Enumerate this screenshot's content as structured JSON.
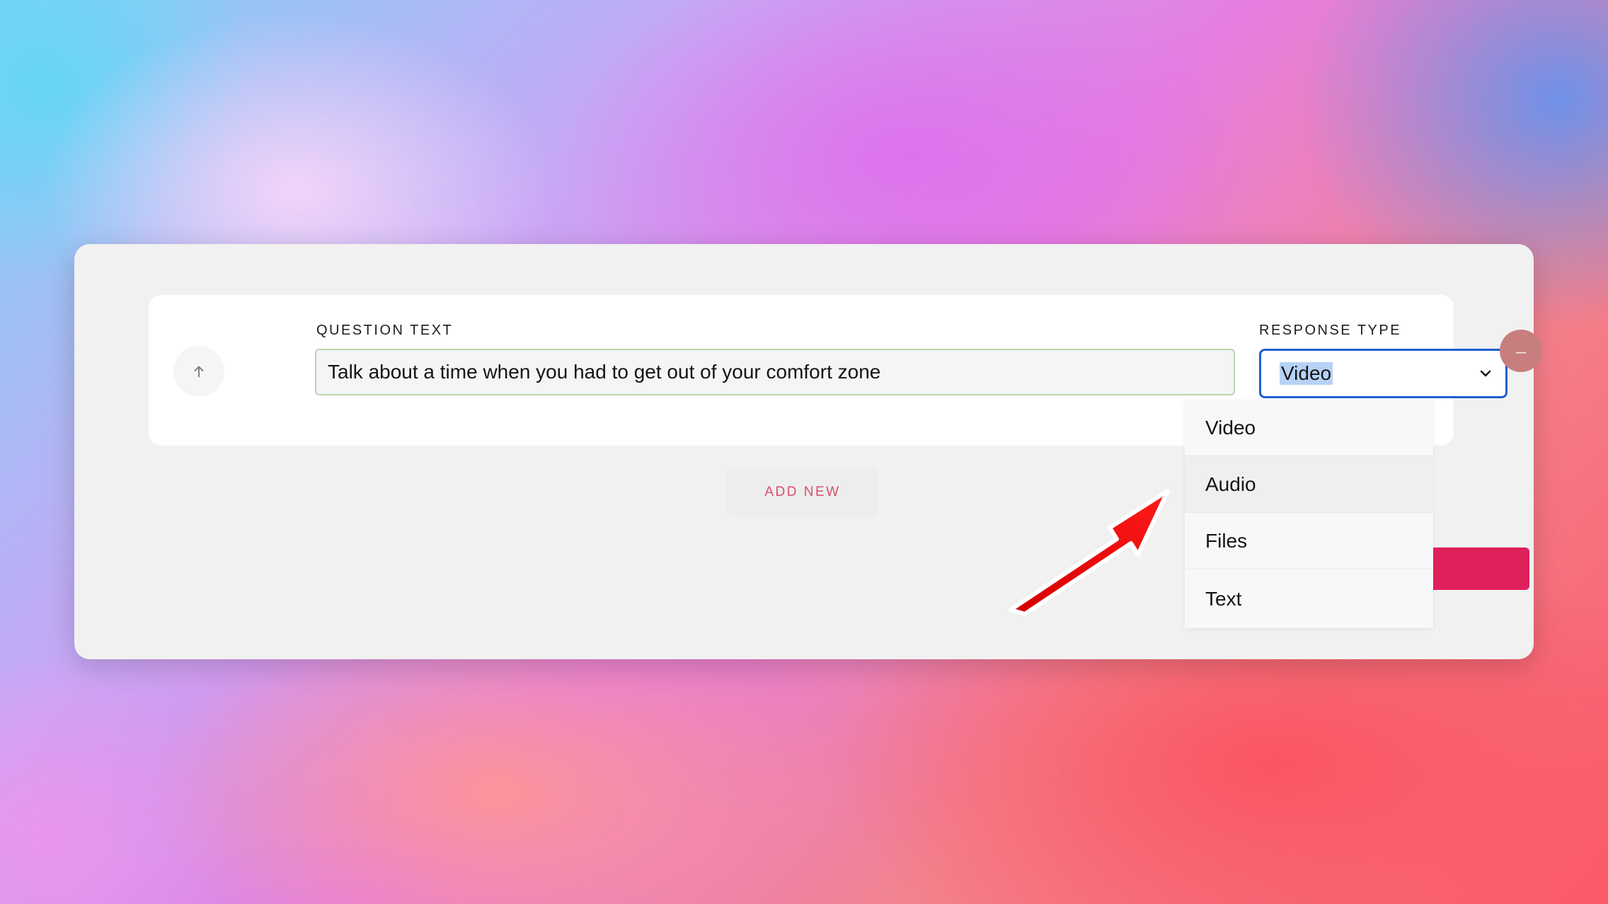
{
  "question": {
    "label": "QUESTION TEXT",
    "value": "Talk about a time when you had to get out of your comfort zone"
  },
  "response": {
    "label": "RESPONSE TYPE",
    "selected": "Video",
    "options": [
      "Video",
      "Audio",
      "Files",
      "Text"
    ]
  },
  "actions": {
    "add_new_label": "ADD NEW",
    "remove_symbol": "–"
  },
  "icons": {
    "move_up": "arrow-up-icon",
    "select": "chevron-down-icon",
    "annotation": "red-arrow-annotation"
  },
  "colors": {
    "accent": "#e0205a",
    "focus_border": "#1f5fd0",
    "input_border": "#b9d4ad",
    "remove_button": "#c87e7e",
    "annotation_arrow": "#ff1010"
  }
}
